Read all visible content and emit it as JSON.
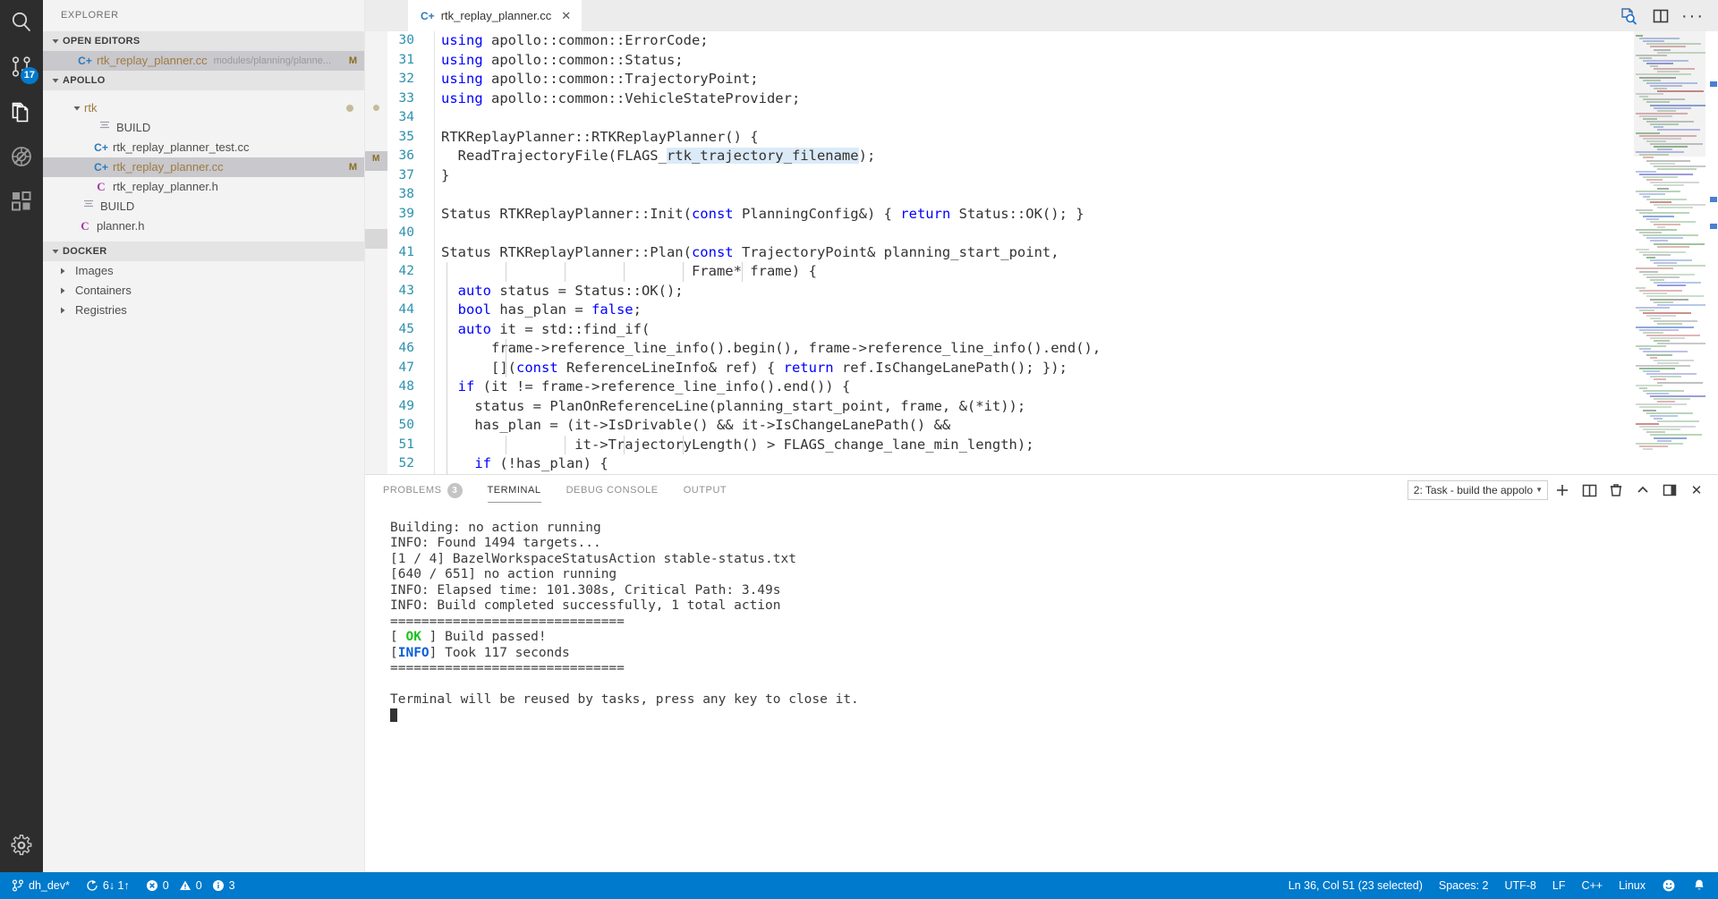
{
  "activitybar": {
    "items": [
      {
        "name": "search-icon",
        "title": "Search"
      },
      {
        "name": "source-control-icon",
        "title": "Source Control",
        "badge": "17"
      },
      {
        "name": "files-explorer-icon",
        "title": "Explorer"
      },
      {
        "name": "debug-disabled-icon",
        "title": "Run and Debug"
      },
      {
        "name": "extensions-icon",
        "title": "Extensions"
      }
    ],
    "bottom": [
      {
        "name": "gear-icon",
        "title": "Manage"
      }
    ]
  },
  "sidebar": {
    "title": "EXPLORER",
    "open_editors": {
      "label": "OPEN EDITORS",
      "items": [
        {
          "name": "rtk_replay_planner.cc",
          "path": "modules/planning/planne...",
          "flag": "M",
          "icon": "cpp",
          "selected": true
        }
      ]
    },
    "apollo": {
      "label": "APOLLO",
      "items": [
        {
          "name": "rtk",
          "icon": "folder",
          "depth": 2,
          "expanded": true,
          "dirty": true,
          "color": "folder"
        },
        {
          "name": "BUILD",
          "icon": "build",
          "depth": 3
        },
        {
          "name": "rtk_replay_planner_test.cc",
          "icon": "cpp",
          "depth": 3
        },
        {
          "name": "rtk_replay_planner.cc",
          "icon": "cpp",
          "depth": 3,
          "flag": "M",
          "selected": true
        },
        {
          "name": "rtk_replay_planner.h",
          "icon": "h",
          "depth": 3
        },
        {
          "name": "BUILD",
          "icon": "build",
          "depth": 2
        },
        {
          "name": "planner.h",
          "icon": "h",
          "depth": 2
        }
      ]
    },
    "docker": {
      "label": "DOCKER",
      "items": [
        {
          "name": "Images"
        },
        {
          "name": "Containers"
        },
        {
          "name": "Registries"
        }
      ]
    }
  },
  "editor": {
    "tab": {
      "label": "rtk_replay_planner.cc",
      "icon": "cpp-file-icon",
      "close": "✕"
    },
    "actions": [
      {
        "name": "find-references-icon"
      },
      {
        "name": "split-editor-icon"
      },
      {
        "name": "more-actions-icon",
        "glyph": "···"
      }
    ],
    "first_line_number": 30,
    "lines": [
      {
        "n": 30,
        "tokens": [
          {
            "t": "using",
            "c": "kw"
          },
          {
            "t": " apollo::common::ErrorCode;"
          }
        ]
      },
      {
        "n": 31,
        "tokens": [
          {
            "t": "using",
            "c": "kw"
          },
          {
            "t": " apollo::common::Status;"
          }
        ]
      },
      {
        "n": 32,
        "tokens": [
          {
            "t": "using",
            "c": "kw"
          },
          {
            "t": " apollo::common::TrajectoryPoint;"
          }
        ]
      },
      {
        "n": 33,
        "tokens": [
          {
            "t": "using",
            "c": "kw"
          },
          {
            "t": " apollo::common::VehicleStateProvider;"
          }
        ]
      },
      {
        "n": 34,
        "tokens": []
      },
      {
        "n": 35,
        "tokens": [
          {
            "t": "RTKReplayPlanner::RTKReplayPlanner() {"
          }
        ]
      },
      {
        "n": 36,
        "tokens": [
          {
            "t": "  ReadTrajectoryFile(FLAGS_"
          },
          {
            "t": "rtk_trajectory_filename",
            "c": "sel"
          },
          {
            "t": ");"
          }
        ]
      },
      {
        "n": 37,
        "tokens": [
          {
            "t": "}"
          }
        ]
      },
      {
        "n": 38,
        "tokens": []
      },
      {
        "n": 39,
        "tokens": [
          {
            "t": "Status RTKReplayPlanner::Init("
          },
          {
            "t": "const",
            "c": "kw"
          },
          {
            "t": " PlanningConfig&) { "
          },
          {
            "t": "return",
            "c": "ctrl"
          },
          {
            "t": " Status::OK(); }"
          }
        ]
      },
      {
        "n": 40,
        "tokens": []
      },
      {
        "n": 41,
        "tokens": [
          {
            "t": "Status RTKReplayPlanner::Plan("
          },
          {
            "t": "const",
            "c": "kw"
          },
          {
            "t": " TrajectoryPoint& planning_start_point,"
          }
        ]
      },
      {
        "n": 42,
        "tokens": [
          {
            "t": "                              Frame* frame) {"
          }
        ]
      },
      {
        "n": 43,
        "tokens": [
          {
            "t": "  "
          },
          {
            "t": "auto",
            "c": "kw"
          },
          {
            "t": " status = Status::OK();"
          }
        ]
      },
      {
        "n": 44,
        "tokens": [
          {
            "t": "  "
          },
          {
            "t": "bool",
            "c": "kw"
          },
          {
            "t": " has_plan = "
          },
          {
            "t": "false",
            "c": "kw"
          },
          {
            "t": ";"
          }
        ]
      },
      {
        "n": 45,
        "tokens": [
          {
            "t": "  "
          },
          {
            "t": "auto",
            "c": "kw"
          },
          {
            "t": " it = std::find_if("
          }
        ]
      },
      {
        "n": 46,
        "tokens": [
          {
            "t": "      frame->reference_line_info().begin(), frame->reference_line_info().end(),"
          }
        ]
      },
      {
        "n": 47,
        "tokens": [
          {
            "t": "      []("
          },
          {
            "t": "const",
            "c": "kw"
          },
          {
            "t": " ReferenceLineInfo& ref) { "
          },
          {
            "t": "return",
            "c": "ctrl"
          },
          {
            "t": " ref.IsChangeLanePath(); });"
          }
        ]
      },
      {
        "n": 48,
        "tokens": [
          {
            "t": "  "
          },
          {
            "t": "if",
            "c": "ctrl"
          },
          {
            "t": " (it != frame->reference_line_info().end()) {"
          }
        ]
      },
      {
        "n": 49,
        "tokens": [
          {
            "t": "    status = PlanOnReferenceLine(planning_start_point, frame, &(*it));"
          }
        ]
      },
      {
        "n": 50,
        "tokens": [
          {
            "t": "    has_plan = (it->IsDrivable() && it->IsChangeLanePath() &&"
          }
        ]
      },
      {
        "n": 51,
        "tokens": [
          {
            "t": "                it->TrajectoryLength() > FLAGS_change_lane_min_length);"
          }
        ]
      },
      {
        "n": 52,
        "tokens": [
          {
            "t": "    "
          },
          {
            "t": "if",
            "c": "ctrl"
          },
          {
            "t": " (!has_plan) {"
          }
        ]
      }
    ]
  },
  "panel": {
    "tabs": [
      {
        "label": "PROBLEMS",
        "badge": "3",
        "active": false
      },
      {
        "label": "TERMINAL",
        "active": true
      },
      {
        "label": "DEBUG CONSOLE",
        "active": false
      },
      {
        "label": "OUTPUT",
        "active": false
      }
    ],
    "terminal_select": "2: Task - build the appolo",
    "actions": [
      {
        "name": "new-terminal-icon",
        "glyph": "+"
      },
      {
        "name": "split-terminal-icon"
      },
      {
        "name": "kill-terminal-icon"
      },
      {
        "name": "maximize-panel-icon"
      },
      {
        "name": "toggle-panel-icon"
      },
      {
        "name": "close-panel-icon",
        "glyph": "✕"
      }
    ],
    "terminal_lines": [
      [
        {
          "t": "Building: no action running"
        }
      ],
      [
        {
          "t": "INFO: Found 1494 targets..."
        }
      ],
      [
        {
          "t": "[1 / 4] BazelWorkspaceStatusAction stable-status.txt"
        }
      ],
      [
        {
          "t": "[640 / 651] no action running"
        }
      ],
      [
        {
          "t": "INFO: Elapsed time: 101.308s, Critical Path: 3.49s"
        }
      ],
      [
        {
          "t": "INFO: Build completed successfully, 1 total action"
        }
      ],
      [
        {
          "t": "=============================="
        }
      ],
      [
        {
          "t": "[ "
        },
        {
          "t": "OK",
          "c": "ok"
        },
        {
          "t": " ] Build passed!"
        }
      ],
      [
        {
          "t": "["
        },
        {
          "t": "INFO",
          "c": "info"
        },
        {
          "t": "] Took 117 seconds"
        }
      ],
      [
        {
          "t": "=============================="
        }
      ],
      [
        {
          "t": ""
        }
      ],
      [
        {
          "t": "Terminal will be reused by tasks, press any key to close it."
        }
      ]
    ]
  },
  "statusbar": {
    "left": [
      {
        "name": "remote-branch",
        "icon": "branch-icon",
        "label": "dh_dev*"
      },
      {
        "name": "sync",
        "icon": "sync-icon",
        "label": "6↓ 1↑"
      },
      {
        "name": "problems",
        "icon": "error-icon",
        "label": "0",
        "icon2": "warning-icon",
        "label2": "0",
        "icon3": "info-icon",
        "label3": "3"
      }
    ],
    "right": [
      {
        "name": "cursor-position",
        "label": "Ln 36, Col 51 (23 selected)"
      },
      {
        "name": "indentation",
        "label": "Spaces: 2"
      },
      {
        "name": "encoding",
        "label": "UTF-8"
      },
      {
        "name": "eol",
        "label": "LF"
      },
      {
        "name": "language-mode",
        "label": "C++"
      },
      {
        "name": "platform",
        "label": "Linux"
      },
      {
        "name": "feedback",
        "icon": "smiley-icon"
      },
      {
        "name": "notifications",
        "icon": "bell-icon"
      }
    ]
  },
  "colors": {
    "accent": "#007acc",
    "activitybar_bg": "#2d2d2d",
    "sidebar_bg": "#f3f3f3",
    "editor_bg": "#ffffff",
    "selection": "#dbeaf7",
    "keyword": "#0000ff",
    "linenumber": "#2b91af",
    "ok_green": "#1fc01f",
    "info_blue": "#0b5fd8"
  }
}
